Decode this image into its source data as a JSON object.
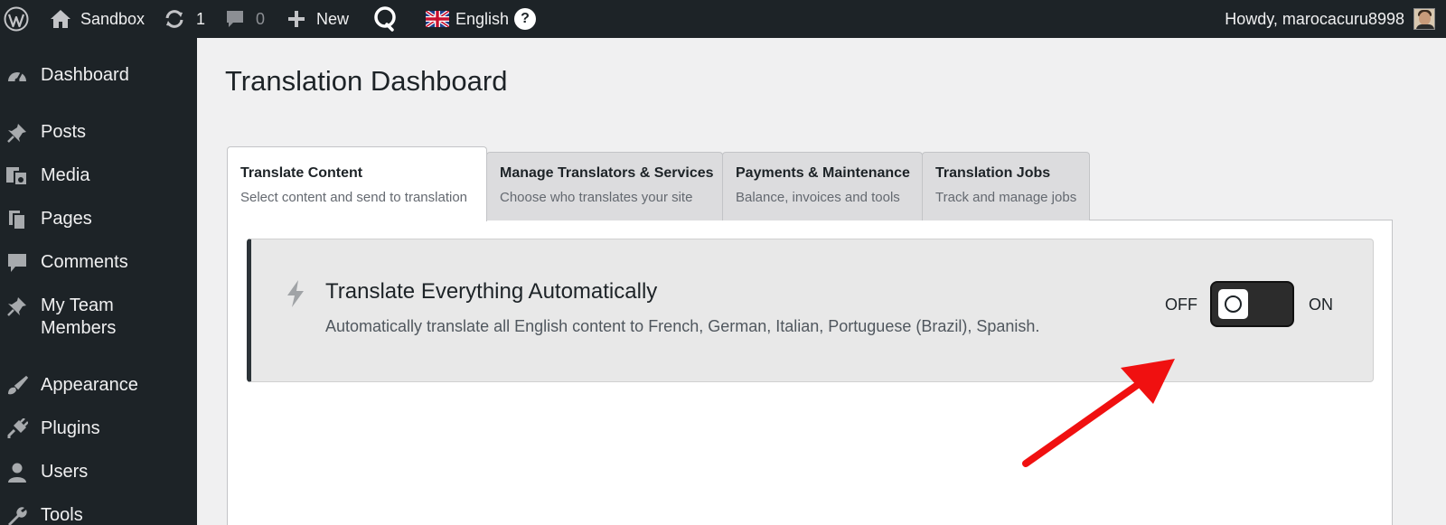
{
  "adminbar": {
    "site_name": "Sandbox",
    "updates_count": "1",
    "comments_count": "0",
    "new_label": "New",
    "language_label": "English",
    "help_label": "?",
    "howdy_text": "Howdy, marocacuru8998"
  },
  "sidebar": {
    "items": [
      {
        "label": "Dashboard",
        "icon": "dashboard-icon"
      },
      {
        "label": "Posts",
        "icon": "pin-icon"
      },
      {
        "label": "Media",
        "icon": "media-icon"
      },
      {
        "label": "Pages",
        "icon": "pages-icon"
      },
      {
        "label": "Comments",
        "icon": "comment-icon"
      },
      {
        "label": "My Team Members",
        "icon": "pin-icon"
      },
      {
        "label": "Appearance",
        "icon": "brush-icon"
      },
      {
        "label": "Plugins",
        "icon": "plugin-icon"
      },
      {
        "label": "Users",
        "icon": "user-icon"
      },
      {
        "label": "Tools",
        "icon": "wrench-icon"
      }
    ]
  },
  "main": {
    "title": "Translation Dashboard",
    "tabs": [
      {
        "title": "Translate Content",
        "subtitle": "Select content and send to translation"
      },
      {
        "title": "Manage Translators & Services",
        "subtitle": "Choose who translates your site"
      },
      {
        "title": "Payments & Maintenance",
        "subtitle": "Balance, invoices and tools"
      },
      {
        "title": "Translation Jobs",
        "subtitle": "Track and manage jobs"
      }
    ],
    "auto_translate": {
      "title": "Translate Everything Automatically",
      "description": "Automatically translate all English content to French, German, Italian, Portuguese (Brazil), Spanish.",
      "off_label": "OFF",
      "on_label": "ON",
      "state": "off"
    }
  },
  "colors": {
    "adminbar_bg": "#1d2327",
    "annotation_arrow": "#f01010"
  }
}
